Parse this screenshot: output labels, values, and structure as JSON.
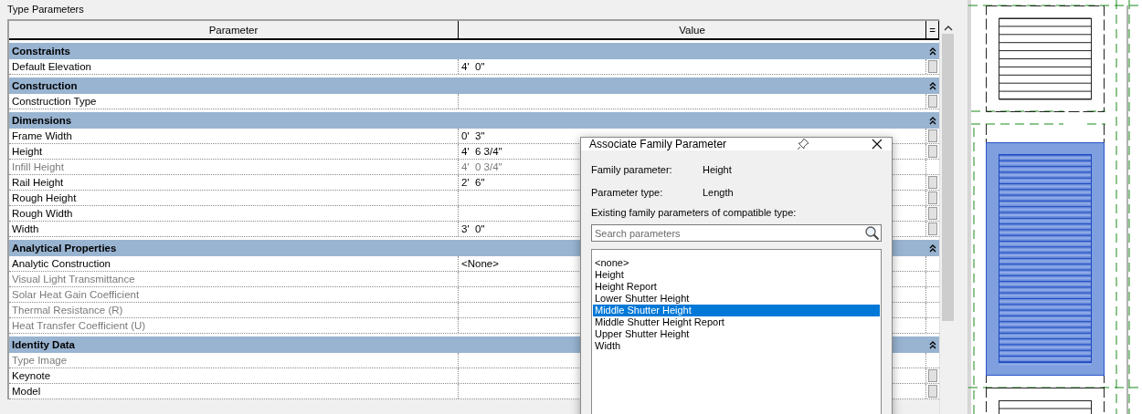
{
  "panel_title": "Type Parameters",
  "table": {
    "columns": [
      "Parameter",
      "Value",
      "="
    ],
    "groups": [
      {
        "name": "Constraints",
        "expanded": true,
        "rows": [
          {
            "parameter": "Default Elevation",
            "value": "4'  0\"",
            "disabled": false,
            "edit_button": true
          }
        ]
      },
      {
        "name": "Construction",
        "expanded": true,
        "rows": [
          {
            "parameter": "Construction Type",
            "disabled": false,
            "edit_button": true
          }
        ]
      },
      {
        "name": "Dimensions",
        "expanded": true,
        "rows": [
          {
            "parameter": "Frame Width",
            "value": "0'  3\"",
            "disabled": false,
            "edit_button": true
          },
          {
            "parameter": "Height",
            "value": "4'  6 3/4\"",
            "disabled": false,
            "edit_button": true
          },
          {
            "parameter": "Infill Height",
            "value": "4'  0 3/4\"",
            "disabled": true,
            "edit_button": false
          },
          {
            "parameter": "Rail Height",
            "value": "2'  6\"",
            "disabled": false,
            "edit_button": true
          },
          {
            "parameter": "Rough Height",
            "disabled": false,
            "edit_button": true
          },
          {
            "parameter": "Rough Width",
            "disabled": false,
            "edit_button": true
          },
          {
            "parameter": "Width",
            "value": "3'  0\"",
            "disabled": false,
            "edit_button": true
          }
        ]
      },
      {
        "name": "Analytical Properties",
        "expanded": true,
        "rows": [
          {
            "parameter": "Analytic Construction",
            "value": "<None>",
            "disabled": false,
            "edit_button": false
          },
          {
            "parameter": "Visual Light Transmittance",
            "disabled": true,
            "edit_button": false
          },
          {
            "parameter": "Solar Heat Gain Coefficient",
            "disabled": true,
            "edit_button": false
          },
          {
            "parameter": "Thermal Resistance (R)",
            "disabled": true,
            "edit_button": false
          },
          {
            "parameter": "Heat Transfer Coefficient (U)",
            "disabled": true,
            "edit_button": false
          }
        ]
      },
      {
        "name": "Identity Data",
        "expanded": true,
        "rows": [
          {
            "parameter": "Type Image",
            "disabled": true,
            "edit_button": false
          },
          {
            "parameter": "Keynote",
            "disabled": false,
            "edit_button": true
          },
          {
            "parameter": "Model",
            "disabled": false,
            "edit_button": true
          }
        ]
      }
    ]
  },
  "dialog": {
    "title": "Associate Family Parameter",
    "fields": [
      {
        "label": "Family parameter:",
        "value": "Height"
      },
      {
        "label": "Parameter type:",
        "value": "Length"
      }
    ],
    "list_label": "Existing family parameters of compatible type:",
    "search": {
      "placeholder": "Search parameters"
    },
    "items": [
      {
        "label": "<none>",
        "selected": false
      },
      {
        "label": "Height",
        "selected": false
      },
      {
        "label": "Height Report",
        "selected": false
      },
      {
        "label": "Lower Shutter Height",
        "selected": false
      },
      {
        "label": "Middle Shutter Height",
        "selected": true
      },
      {
        "label": "Middle Shutter Height Report",
        "selected": false
      },
      {
        "label": "Upper Shutter Height",
        "selected": false
      },
      {
        "label": "Width",
        "selected": false
      }
    ]
  }
}
